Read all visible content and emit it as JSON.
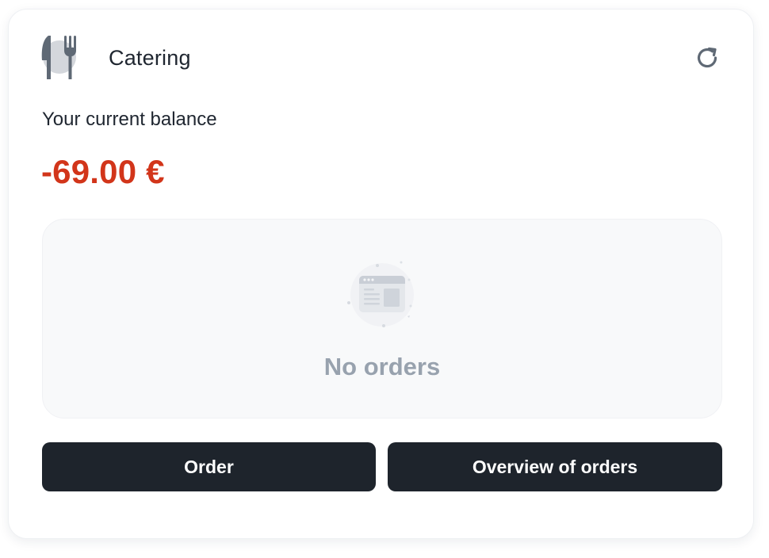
{
  "header": {
    "logo_icon": "cutlery-icon",
    "title": "Catering",
    "refresh_icon": "refresh-icon"
  },
  "balance": {
    "label": "Your current balance",
    "amount": "-69.00 €",
    "amount_color": "#d2351a"
  },
  "orders": {
    "empty_icon": "browser-window-icon",
    "empty_text": "No orders"
  },
  "actions": {
    "order_label": "Order",
    "overview_label": "Overview of orders",
    "button_color": "#1e242c"
  }
}
